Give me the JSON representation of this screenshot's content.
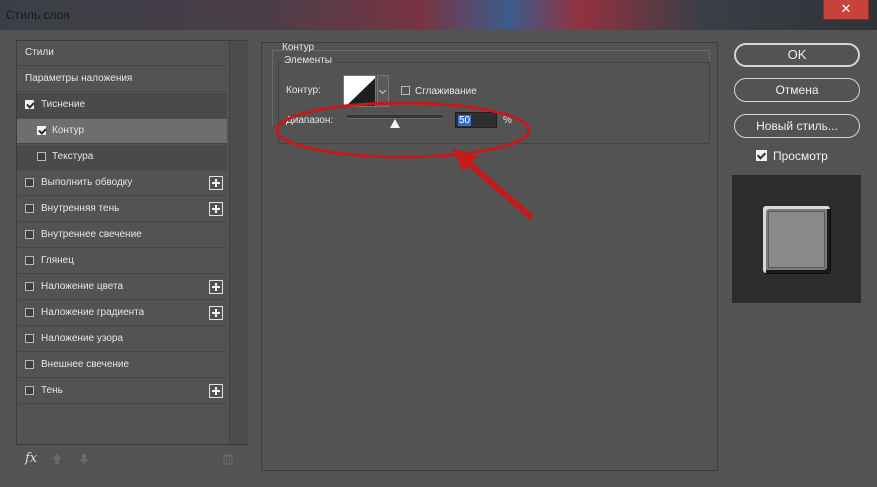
{
  "window": {
    "title": "Стиль слоя",
    "close_glyph": "✕"
  },
  "left_panel": {
    "items": [
      {
        "label": "Стили",
        "checkbox": false,
        "checked": false,
        "plus": false
      },
      {
        "label": "Параметры наложения",
        "checkbox": false,
        "checked": false,
        "plus": false
      },
      {
        "label": "Тиснение",
        "checkbox": true,
        "checked": true,
        "plus": false
      },
      {
        "label": "Контур",
        "checkbox": true,
        "checked": true,
        "plus": false,
        "selected": true
      },
      {
        "label": "Текстура",
        "checkbox": true,
        "checked": false,
        "plus": false
      },
      {
        "label": "Выполнить обводку",
        "checkbox": true,
        "checked": false,
        "plus": true
      },
      {
        "label": "Внутренняя тень",
        "checkbox": true,
        "checked": false,
        "plus": true
      },
      {
        "label": "Внутреннее свечение",
        "checkbox": true,
        "checked": false,
        "plus": false
      },
      {
        "label": "Глянец",
        "checkbox": true,
        "checked": false,
        "plus": false
      },
      {
        "label": "Наложение цвета",
        "checkbox": true,
        "checked": false,
        "plus": true
      },
      {
        "label": "Наложение градиента",
        "checkbox": true,
        "checked": false,
        "plus": true
      },
      {
        "label": "Наложение узора",
        "checkbox": true,
        "checked": false,
        "plus": false
      },
      {
        "label": "Внешнее свечение",
        "checkbox": true,
        "checked": false,
        "plus": false
      },
      {
        "label": "Тень",
        "checkbox": true,
        "checked": false,
        "plus": true
      }
    ],
    "footer": {
      "fx_label": "fx",
      "icons": [
        "move-up-icon",
        "move-down-icon",
        "trash-icon"
      ]
    }
  },
  "contour_section": {
    "group_title": "Контур",
    "subgroup_title": "Элементы",
    "contour_label": "Контур:",
    "smoothing_label": "Сглаживание",
    "smoothing_checked": false,
    "range_label": "Диапазон:",
    "range_value": "50",
    "range_percent": 50,
    "range_unit": "%"
  },
  "actions": {
    "ok_label": "OK",
    "cancel_label": "Отмена",
    "new_style_label": "Новый стиль...",
    "preview_label": "Просмотр",
    "preview_checked": true
  },
  "colors": {
    "background": "#535353",
    "annotation_red": "#c41a1a",
    "selected_row": "#6e6e6e",
    "input_highlight": "#2f6fd0"
  }
}
